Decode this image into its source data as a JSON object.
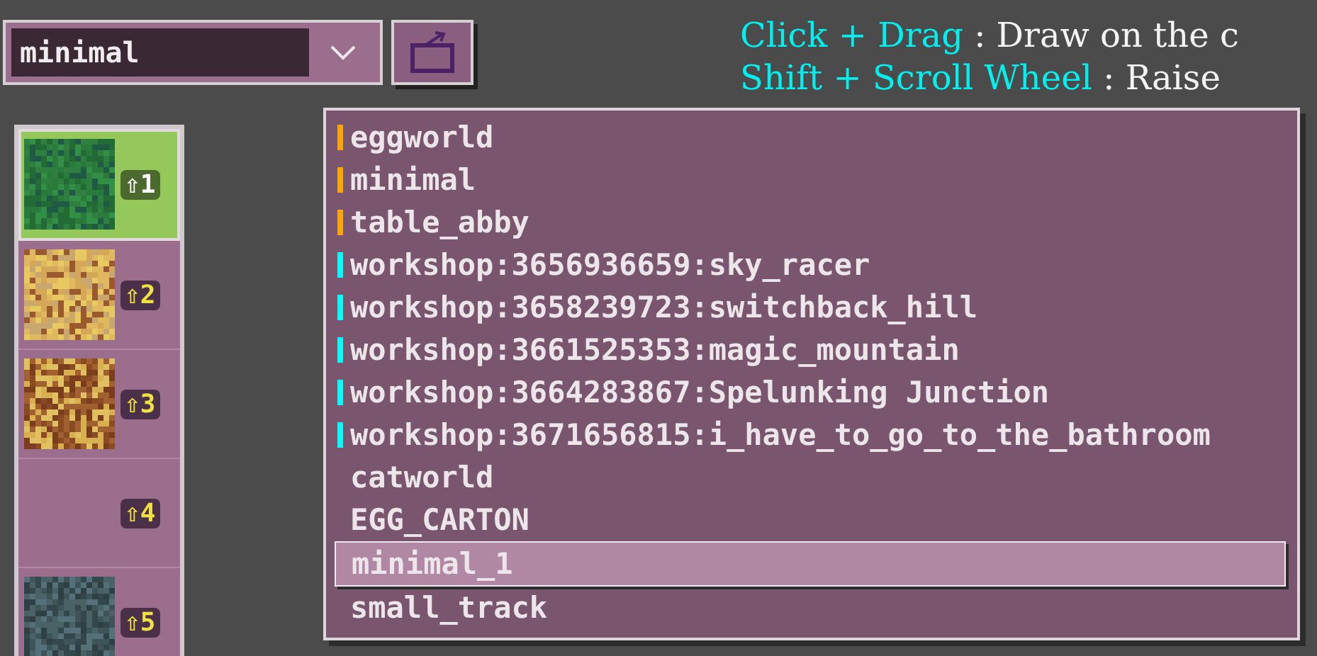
{
  "combobox": {
    "value": "minimal"
  },
  "help": [
    {
      "keys": "Click + Drag",
      "text": ": Draw on the c"
    },
    {
      "keys": "Shift + Scroll Wheel",
      "text": ": Raise"
    }
  ],
  "tiles": [
    {
      "kind": "grass",
      "badge": "⇧1",
      "selected": true
    },
    {
      "kind": "sand",
      "badge": "⇧2",
      "selected": false
    },
    {
      "kind": "dirt",
      "badge": "⇧3",
      "selected": false
    },
    {
      "kind": "empty",
      "badge": "⇧4",
      "selected": false
    },
    {
      "kind": "stone",
      "badge": "⇧5",
      "selected": false
    }
  ],
  "dropdown": [
    {
      "label": "eggworld",
      "color": "#ffa500",
      "selected": false
    },
    {
      "label": "minimal",
      "color": "#ffa500",
      "selected": false
    },
    {
      "label": "table_abby",
      "color": "#ffa500",
      "selected": false
    },
    {
      "label": "workshop:3656936659:sky_racer",
      "color": "#00ffff",
      "selected": false
    },
    {
      "label": "workshop:3658239723:switchback_hill",
      "color": "#00ffff",
      "selected": false
    },
    {
      "label": "workshop:3661525353:magic_mountain",
      "color": "#00ffff",
      "selected": false
    },
    {
      "label": "workshop:3664283867:Spelunking Junction",
      "color": "#00ffff",
      "selected": false
    },
    {
      "label": "workshop:3671656815:i_have_to_go_to_the_bathroom",
      "color": "#00ffff",
      "selected": false
    },
    {
      "label": "catworld",
      "selected": false
    },
    {
      "label": "EGG_CARTON",
      "selected": false
    },
    {
      "label": "minimal_1",
      "selected": true
    },
    {
      "label": "small_track",
      "selected": false
    }
  ]
}
